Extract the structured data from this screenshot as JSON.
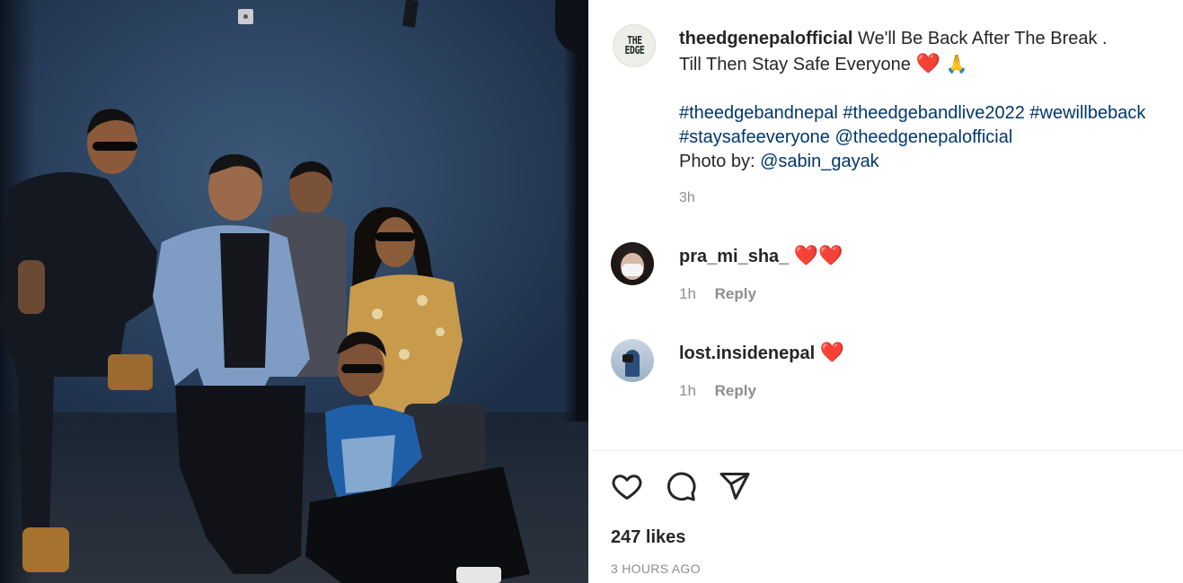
{
  "post": {
    "username": "theedgenepalofficial",
    "avatar_text_line1": "THE",
    "avatar_text_line2": "EDGE",
    "caption_line1": "We'll Be Back After The Break .",
    "caption_line2": "Till Then Stay Safe Everyone",
    "caption_emoji_heart": "❤️",
    "caption_emoji_pray": "🙏",
    "hashtags_line1": [
      "#theedgebandnepal",
      "#theedgebandlive2022",
      "#wewillbeback"
    ],
    "hashtags_line2_tag": "#staysafeeveryone",
    "hashtags_line2_mention": "@theedgenepalofficial",
    "photo_by_label": "Photo by:",
    "photo_by_mention": "@sabin_gayak",
    "time_ago": "3h"
  },
  "comments": [
    {
      "username": "pra_mi_sha_",
      "text": "❤️❤️",
      "time": "1h",
      "reply_label": "Reply"
    },
    {
      "username": "lost.insidenepal",
      "text": "❤️",
      "time": "1h",
      "reply_label": "Reply"
    }
  ],
  "actions": {
    "like_icon": "heart-outline-icon",
    "comment_icon": "comment-bubble-icon",
    "share_icon": "paper-plane-icon"
  },
  "likes_text": "247 likes",
  "date_text": "3 HOURS AGO",
  "colors": {
    "link": "#00376b",
    "secondary_text": "#8e8e8e",
    "primary_text": "#262626",
    "heart": "#e0102a"
  }
}
